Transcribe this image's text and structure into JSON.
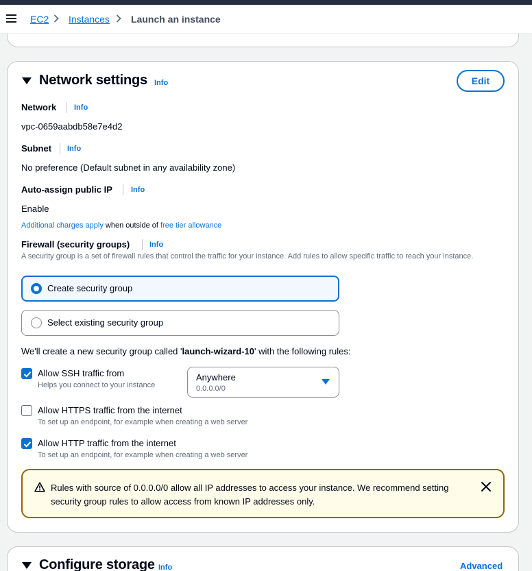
{
  "breadcrumb": {
    "items": [
      "EC2",
      "Instances"
    ],
    "current": "Launch an instance"
  },
  "network_section": {
    "title": "Network settings",
    "info": "Info",
    "edit_label": "Edit",
    "network": {
      "label": "Network",
      "info": "Info",
      "value": "vpc-0659aabdb58e7e4d2"
    },
    "subnet": {
      "label": "Subnet",
      "info": "Info",
      "value": "No preference (Default subnet in any availability zone)"
    },
    "auto_ip": {
      "label": "Auto-assign public IP",
      "info": "Info",
      "value": "Enable"
    },
    "charges_note": {
      "link1": "Additional charges apply",
      "middle": " when outside of ",
      "link2": "free tier allowance"
    },
    "firewall": {
      "label": "Firewall (security groups)",
      "info": "Info",
      "description": "A security group is a set of firewall rules that control the traffic for your instance. Add rules to allow specific traffic to reach your instance.",
      "options": [
        "Create security group",
        "Select existing security group"
      ],
      "selected": "Create security group"
    },
    "create_text": {
      "prefix": "We'll create a new security group called '",
      "name": "launch-wizard-10",
      "suffix": "' with the following rules:"
    },
    "rules": [
      {
        "label": "Allow SSH traffic from",
        "desc": "Helps you connect to your instance",
        "checked": true
      },
      {
        "label": "Allow HTTPS traffic from the internet",
        "desc": "To set up an endpoint, for example when creating a web server",
        "checked": false
      },
      {
        "label": "Allow HTTP traffic from the internet",
        "desc": "To set up an endpoint, for example when creating a web server",
        "checked": true
      }
    ],
    "ssh_source": {
      "value": "Anywhere",
      "sub": "0.0.0.0/0"
    },
    "warning": "Rules with source of 0.0.0.0/0 allow all IP addresses to access your instance. We recommend setting security group rules to allow access from known IP addresses only."
  },
  "storage_section": {
    "title": "Configure storage",
    "info": "Info",
    "advanced_label": "Advanced"
  },
  "colors": {
    "accent": "#0972d3",
    "warning_border": "#8d6605",
    "warning_bg": "#fffce9"
  }
}
